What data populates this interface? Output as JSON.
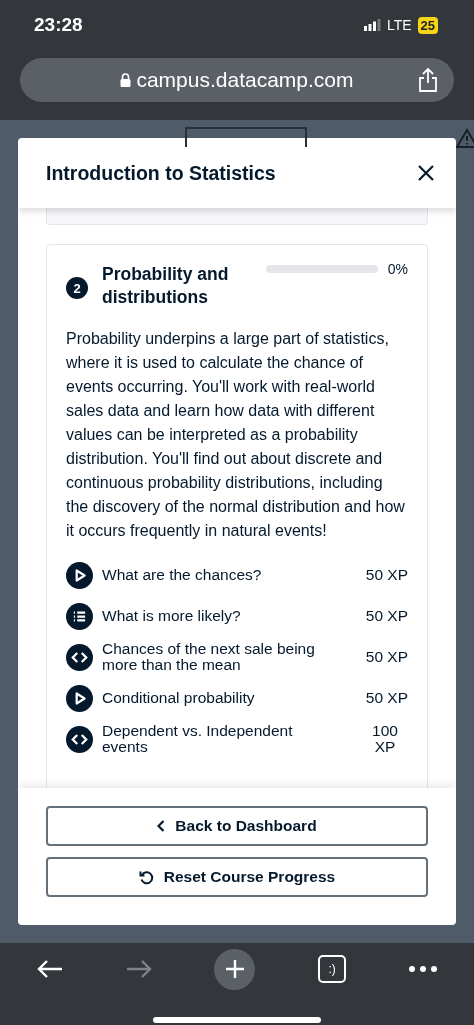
{
  "status_bar": {
    "time": "23:28",
    "network": "LTE",
    "battery": "25"
  },
  "address_bar": {
    "url": "campus.datacamp.com"
  },
  "modal": {
    "title": "Introduction to Statistics",
    "chapter": {
      "number": "2",
      "title": "Probability and distributions",
      "level": 0,
      "progress_label": "0%",
      "description": "Probability underpins a large part of statistics, where it is used to calculate the chance of events occurring. You'll work with real-world sales data and learn how data with different values can be interpreted as a probability distribution. You'll find out about discrete and continuous probability distributions, including the discovery of the normal distribution and how it occurs frequently in natural events!",
      "lessons": [
        {
          "kind": "video",
          "title": "What are the chances?",
          "xp": "50 XP"
        },
        {
          "kind": "exercise",
          "title": "What is more likely?",
          "xp": "50 XP"
        },
        {
          "kind": "code",
          "title": "Chances of the next sale being more than the mean",
          "xp": "50 XP"
        },
        {
          "kind": "video",
          "title": "Conditional probability",
          "xp": "50 XP"
        },
        {
          "kind": "code",
          "title": "Dependent vs. Independent events",
          "xp": "100 XP"
        }
      ]
    },
    "buttons": [
      {
        "kind": "back",
        "label": "Back to Dashboard"
      },
      {
        "kind": "reset",
        "label": "Reset Course Progress"
      }
    ]
  },
  "toolbar": {
    "tab_count": ":)"
  }
}
